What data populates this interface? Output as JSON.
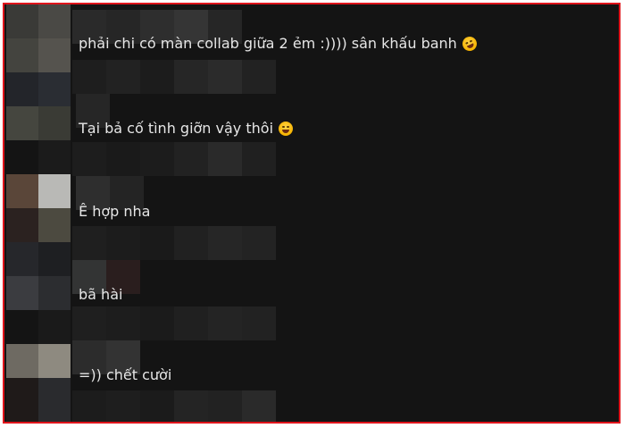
{
  "messages": [
    {
      "text": "phải chi có màn collab giữa 2 ẻm :)))) sân khấu banh",
      "emoji": "rolling-on-floor-laughing-emoji"
    },
    {
      "text": "Tại bả cố tình giỡn vậy thôi",
      "emoji": "grinning-sweat-emoji"
    },
    {
      "text": "Ê hợp nha"
    },
    {
      "text": "bã hài"
    },
    {
      "text": "=)) chết cười"
    }
  ],
  "colors": {
    "background": "#141414",
    "border": "#e0141b",
    "text": "#e6e6e6"
  }
}
